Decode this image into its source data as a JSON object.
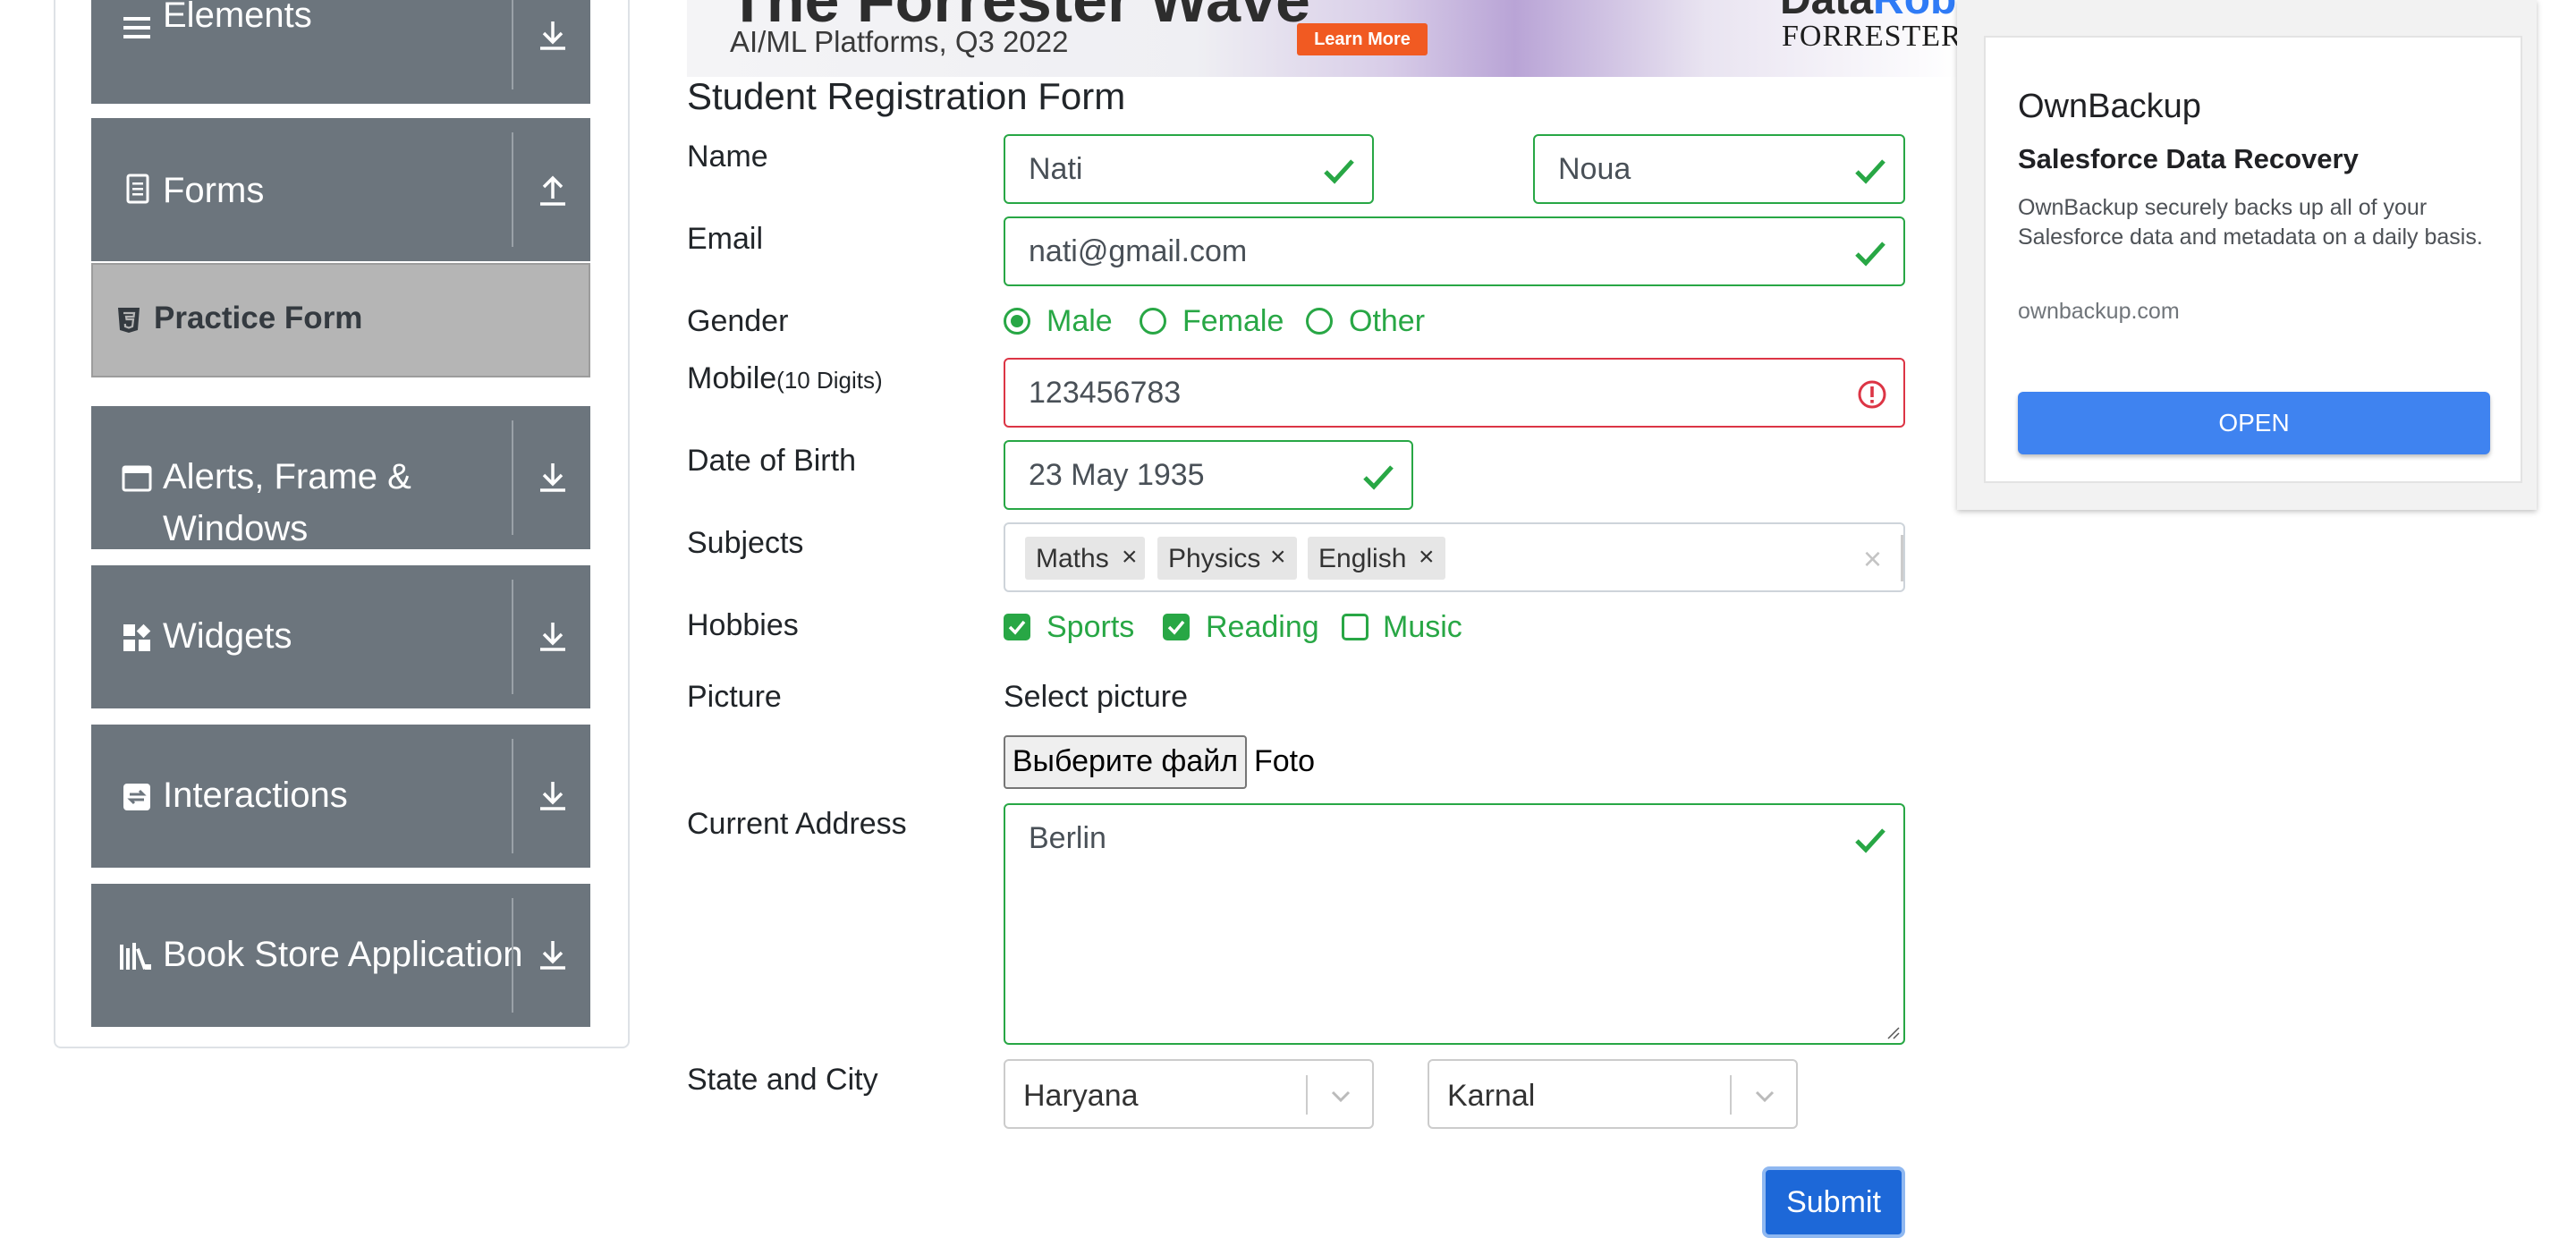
{
  "sidebar": {
    "groups": [
      {
        "label": "Elements",
        "icon": "menu-icon",
        "arrow": "download-arrow-icon"
      },
      {
        "label": "Forms",
        "icon": "document-icon",
        "arrow": "upload-arrow-icon"
      },
      {
        "label": "Alerts, Frame & Windows",
        "label_line1": "Alerts, Frame &",
        "label_line2": "Windows",
        "icon": "window-icon",
        "arrow": "download-arrow-icon"
      },
      {
        "label": "Widgets",
        "icon": "widgets-icon",
        "arrow": "download-arrow-icon"
      },
      {
        "label": "Interactions",
        "icon": "interactions-icon",
        "arrow": "download-arrow-icon"
      },
      {
        "label": "Book Store Application",
        "icon": "books-icon",
        "arrow": "download-arrow-icon"
      }
    ],
    "active_item": {
      "label": "Practice Form",
      "icon": "html5-icon"
    }
  },
  "banner": {
    "headline": "The Forrester Wave",
    "subline": "AI/ML Platforms, Q3 2022",
    "cta": "Learn More",
    "brand_a": "Data",
    "brand_b": "Robot",
    "publisher": "FORRESTER"
  },
  "form": {
    "title": "Student Registration Form",
    "name": {
      "label": "Name",
      "first": "Nati",
      "last": "Noua"
    },
    "email": {
      "label": "Email",
      "value": "nati@gmail.com"
    },
    "gender": {
      "label": "Gender",
      "options": [
        "Male",
        "Female",
        "Other"
      ],
      "selected": "Male"
    },
    "mobile": {
      "label": "Mobile",
      "hint": "(10 Digits)",
      "value": "123456783"
    },
    "dob": {
      "label": "Date of Birth",
      "value": "23 May 1935"
    },
    "subjects": {
      "label": "Subjects",
      "tags": [
        "Maths",
        "Physics",
        "English"
      ],
      "remove_glyph": "×",
      "clear_glyph": "×"
    },
    "hobbies": {
      "label": "Hobbies",
      "options": [
        "Sports",
        "Reading",
        "Music"
      ],
      "checked": [
        "Sports",
        "Reading"
      ]
    },
    "picture": {
      "label": "Picture",
      "prompt": "Select picture",
      "button": "Выберите файл",
      "file": "Foto"
    },
    "address": {
      "label": "Current Address",
      "value": "Berlin"
    },
    "state_city": {
      "label": "State and City",
      "state": "Haryana",
      "city": "Karnal"
    },
    "submit": "Submit"
  },
  "ad": {
    "title": "OwnBackup",
    "headline": "Salesforce Data Recovery",
    "body": "OwnBackup securely backs up all of your Salesforce data and metadata on a daily basis.",
    "url": "ownbackup.com",
    "cta": "OPEN"
  },
  "colors": {
    "sidebar_bg": "#6c757d",
    "active_item_bg": "#b5b5b5",
    "valid": "#28a745",
    "invalid": "#dc3545",
    "primary": "#1d68d8",
    "ad_button": "#3f83f0"
  }
}
